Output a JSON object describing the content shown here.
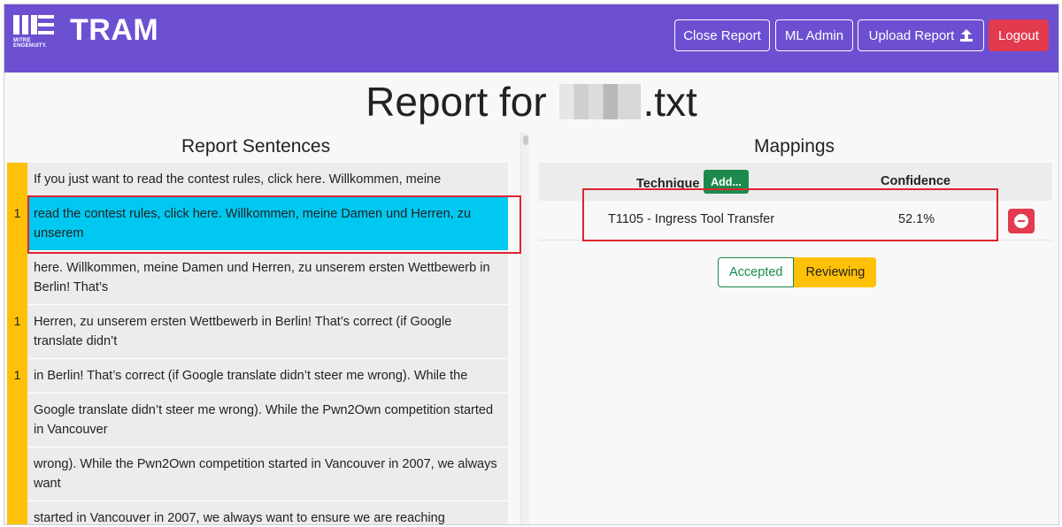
{
  "app": {
    "brand": "TRAM",
    "logo_text": [
      "MITRE",
      "ENGENUITY."
    ]
  },
  "nav": {
    "close_report": "Close Report",
    "ml_admin": "ML Admin",
    "upload_report": "Upload Report",
    "logout": "Logout"
  },
  "report": {
    "title_prefix": "Report for",
    "title_suffix": ".txt"
  },
  "sentences_panel": {
    "title": "Report Sentences",
    "items": [
      {
        "count": "",
        "text": "If you just want to read the contest rules, click here. Willkommen, meine",
        "selected": false
      },
      {
        "count": "1",
        "text": "read the contest rules, click here. Willkommen, meine Damen und Herren, zu unserem",
        "selected": true
      },
      {
        "count": "",
        "text": "here. Willkommen, meine Damen und Herren, zu unserem ersten Wettbewerb in Berlin! That’s",
        "selected": false
      },
      {
        "count": "1",
        "text": "Herren, zu unserem ersten Wettbewerb in Berlin! That’s correct (if Google translate didn’t",
        "selected": false
      },
      {
        "count": "1",
        "text": "in Berlin! That’s correct (if Google translate didn’t steer me wrong). While the",
        "selected": false
      },
      {
        "count": "",
        "text": "Google translate didn’t steer me wrong). While the Pwn2Own competition started in Vancouver",
        "selected": false
      },
      {
        "count": "",
        "text": "wrong). While the Pwn2Own competition started in Vancouver in 2007, we always want",
        "selected": false
      },
      {
        "count": "",
        "text": "started in Vancouver in 2007, we always want to ensure we are reaching",
        "selected": false
      }
    ]
  },
  "mappings_panel": {
    "title": "Mappings",
    "technique_header": "Technique",
    "confidence_header": "Confidence",
    "add_label": "Add...",
    "rows": [
      {
        "technique": "T1105 - Ingress Tool Transfer",
        "confidence": "52.1%"
      }
    ],
    "status_accepted": "Accepted",
    "status_reviewing": "Reviewing",
    "status_active": "Reviewing"
  },
  "colors": {
    "navbar": "#6d4fd1",
    "logout": "#e23a4f",
    "gutter": "#ffc107",
    "selected_sentence": "#00c8f0",
    "success": "#1b8a4c",
    "annotation": "#e0242f"
  },
  "icons": {
    "upload": "upload-icon",
    "remove": "minus-circle-icon"
  }
}
